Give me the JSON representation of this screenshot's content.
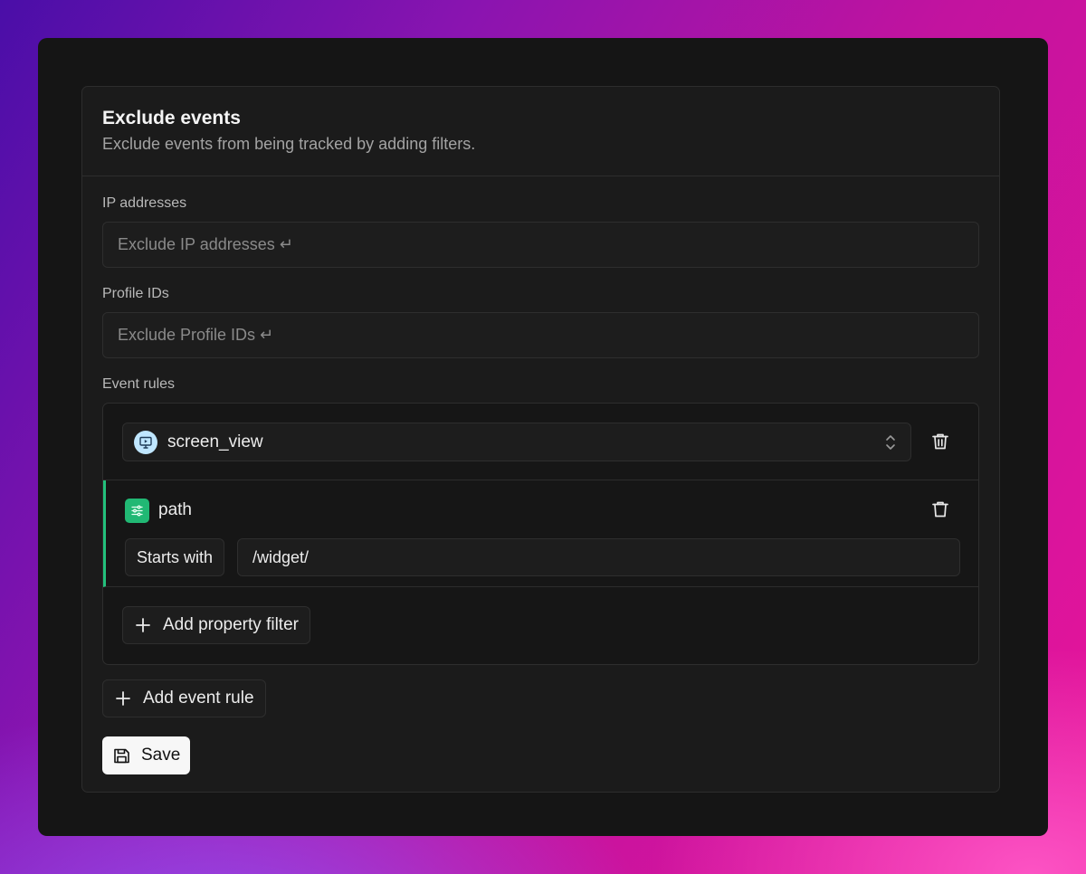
{
  "section": {
    "title": "Exclude events",
    "description": "Exclude events from being tracked by adding filters."
  },
  "ip_addresses": {
    "label": "IP addresses",
    "placeholder": "Exclude IP addresses ↵"
  },
  "profile_ids": {
    "label": "Profile IDs",
    "placeholder": "Exclude Profile IDs ↵"
  },
  "event_rules": {
    "label": "Event rules",
    "rule": {
      "event_name": "screen_view",
      "event_icon": "monitor-play-icon",
      "filter": {
        "property": "path",
        "property_icon": "sliders-icon",
        "operator": "Starts with",
        "value": "/widget/"
      },
      "add_filter_label": "Add property filter"
    },
    "add_rule_label": "Add event rule"
  },
  "save_label": "Save",
  "colors": {
    "accent_green": "#23c07c",
    "event_icon_bg": "#bfe6ff",
    "save_bg": "#f7f7f7"
  }
}
